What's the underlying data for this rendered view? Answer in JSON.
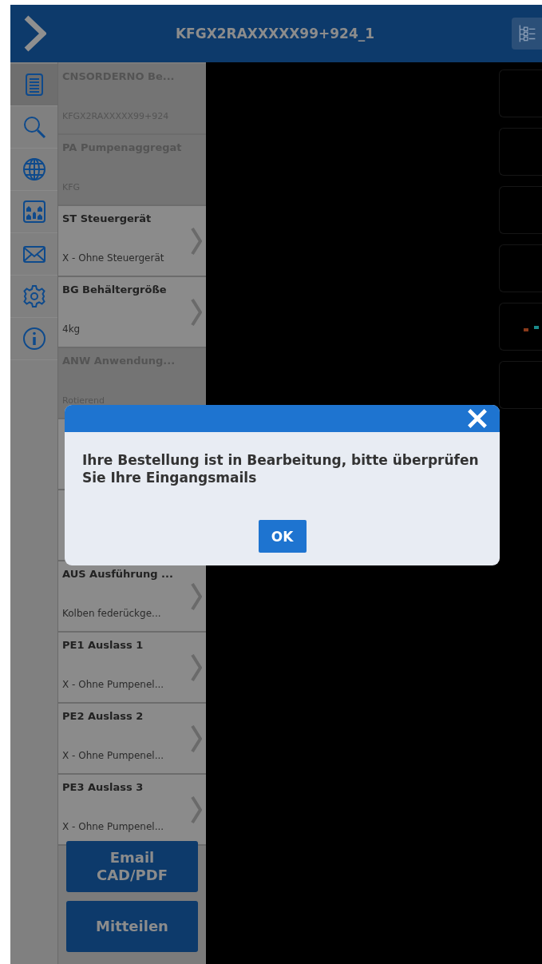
{
  "header": {
    "title": "KFGX2RAXXXXX99+924_1"
  },
  "sidebar": {
    "items": [
      {
        "selected": true
      },
      {
        "selected": false
      },
      {
        "selected": false
      },
      {
        "selected": false
      },
      {
        "selected": false
      },
      {
        "selected": false
      },
      {
        "selected": false
      }
    ]
  },
  "options": [
    {
      "title": "CNSORDERNO Be...",
      "value": "KFGX2RAXXXXX99+924",
      "disabled": true
    },
    {
      "title": "PA Pumpenaggregat",
      "value": "KFG",
      "disabled": true
    },
    {
      "title": "ST Steuergerät",
      "value": "X - Ohne Steuergerät",
      "disabled": false
    },
    {
      "title": "BG Behältergröße",
      "value": "4kg",
      "disabled": false
    },
    {
      "title": "ANW Anwendung...",
      "value": "Rotierend",
      "disabled": true
    },
    {
      "disabled": false
    },
    {
      "disabled": false
    },
    {
      "title": "AUS Ausführung ...",
      "value": "Kolben federückge...",
      "disabled": false
    },
    {
      "title": "PE1 Auslass 1",
      "value": "X - Ohne Pumpenel...",
      "disabled": false
    },
    {
      "title": "PE2 Auslass 2",
      "value": "X - Ohne Pumpenel...",
      "disabled": false
    },
    {
      "title": "PE3 Auslass 3",
      "value": "X - Ohne Pumpenel...",
      "disabled": false
    }
  ],
  "buttons": [
    "Email CAD/PDF",
    "Mitteilen"
  ],
  "dialog": {
    "message": "Ihre Bestellung ist in Bearbeitung, bitte überprüfen Sie Ihre Eingangsmails",
    "button": "OK"
  }
}
